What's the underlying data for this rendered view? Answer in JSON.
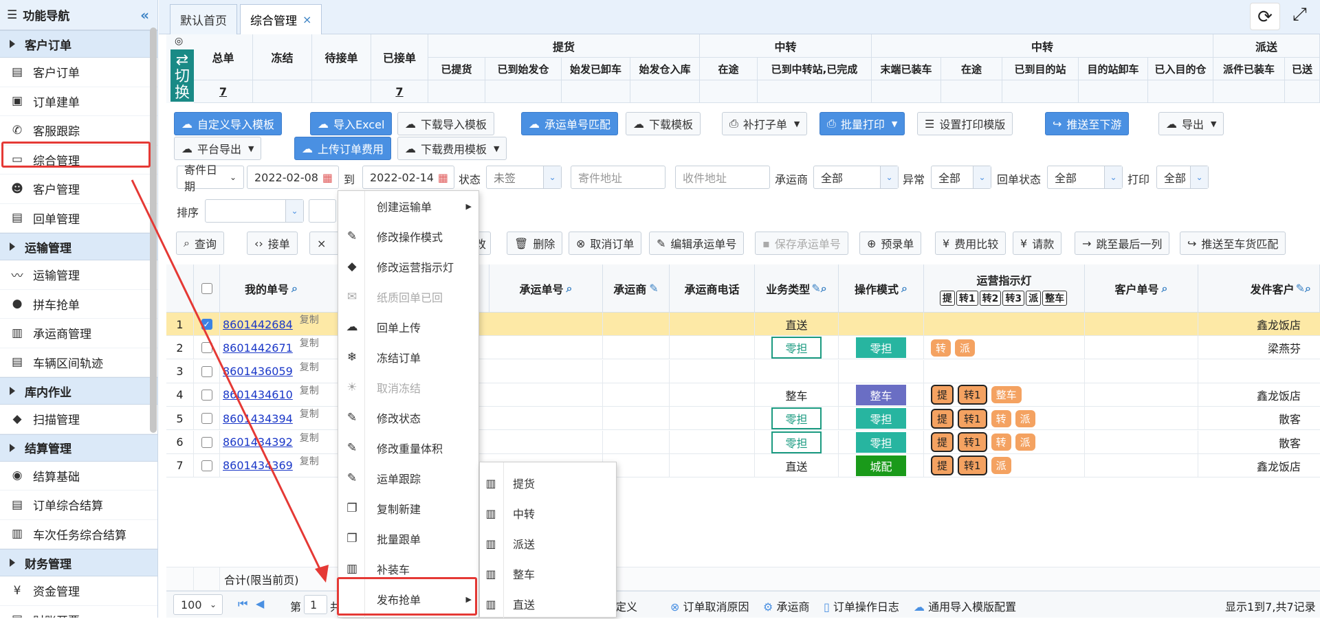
{
  "sidebar": {
    "title": "功能导航",
    "groups": [
      {
        "label": "客户订单",
        "items": [
          "客户订单",
          "订单建单",
          "客服跟踪",
          "综合管理",
          "客户管理",
          "回单管理"
        ]
      },
      {
        "label": "运输管理",
        "items": [
          "运输管理",
          "拼车抢单",
          "承运商管理",
          "车辆区间轨迹"
        ]
      },
      {
        "label": "库内作业",
        "items": [
          "扫描管理"
        ]
      },
      {
        "label": "结算管理",
        "items": [
          "结算基础",
          "订单综合结算",
          "车次任务综合结算"
        ]
      },
      {
        "label": "财务管理",
        "items": [
          "资金管理",
          "财账开票"
        ]
      }
    ]
  },
  "tabs": {
    "home": "默认首页",
    "active": "综合管理",
    "close": "×"
  },
  "stats": {
    "switch": "⇄切换",
    "cols": [
      "总单",
      "冻结",
      "待接单",
      "已接单"
    ],
    "groups": [
      "提货",
      "中转",
      "中转",
      "派送"
    ],
    "sub": [
      "已提货",
      "已到始发仓",
      "始发已卸车",
      "始发仓入库",
      "在途",
      "已到中转站,已完成",
      "末端已装车",
      "在途",
      "已到目的站",
      "目的站卸车",
      "已入目的仓",
      "派件已装车",
      "已送"
    ],
    "total": "7",
    "accepted": "7"
  },
  "toolbar": {
    "custom_import": "自定义导入模板",
    "import_excel": "导入Excel",
    "download_import": "下载导入模板",
    "carrier_match": "承运单号匹配",
    "download_tpl": "下载模板",
    "reprint": "补打子单",
    "batch_print": "批量打印",
    "print_tpl": "设置打印模版",
    "push_downstream": "推送至下游",
    "export": "导出",
    "platform_export": "平台导出",
    "upload_fee": "上传订单费用",
    "download_fee": "下载费用模板"
  },
  "filters": {
    "date_type": "寄件日期",
    "date_from": "2022-02-08",
    "to": "到",
    "date_to": "2022-02-14",
    "status_label": "状态",
    "status": "未签",
    "sender_ph": "寄件地址",
    "receiver_ph": "收件地址",
    "carrier_label": "承运商",
    "carrier": "全部",
    "abnormal_label": "异常",
    "abnormal": "全部",
    "receipt_label": "回单状态",
    "receipt": "全部",
    "print_label": "打印",
    "print": "全部",
    "sort_label": "排序"
  },
  "actions": {
    "query": "查询",
    "accept": "接单",
    "modify_tail": "改",
    "delete": "删除",
    "cancel": "取消订单",
    "edit_carrier_no": "编辑承运单号",
    "save_carrier_no": "保存承运单号",
    "prebook": "预录单",
    "fee_compare": "费用比较",
    "request": "请款",
    "jump_last": "跳至最后一列",
    "push_match": "推送至车货匹配"
  },
  "table": {
    "headers": {
      "my_no": "我的单号",
      "carrier_no": "承运单号",
      "carrier": "承运商",
      "carrier_phone": "承运商电话",
      "biz_type": "业务类型",
      "op_mode": "操作模式",
      "lamp": "运营指示灯",
      "cust_no": "客户单号",
      "sender": "发件客户"
    },
    "lamp_keys": [
      "提",
      "转1",
      "转2",
      "转3",
      "派",
      "整车"
    ],
    "copy": "复制",
    "rows": [
      {
        "idx": "1",
        "no": "8601442684",
        "biz": "直送",
        "op": "",
        "lamps": [],
        "sender": "鑫龙饭店",
        "checked": true
      },
      {
        "idx": "2",
        "no": "8601442671",
        "biz": "零担",
        "op": "零担",
        "lamps": [
          "转",
          "派"
        ],
        "sender": "梁燕芬",
        "checked": false
      },
      {
        "idx": "3",
        "no": "8601436059",
        "biz": "",
        "op": "",
        "lamps": [],
        "sender": "",
        "checked": false
      },
      {
        "idx": "4",
        "no": "8601434610",
        "biz": "整车",
        "op": "整车",
        "lamps": [
          "提",
          "转1",
          "整车"
        ],
        "sender": "鑫龙饭店",
        "checked": false
      },
      {
        "idx": "5",
        "no": "8601434394",
        "biz": "零担",
        "op": "零担",
        "lamps": [
          "提",
          "转1",
          "转",
          "派"
        ],
        "sender": "散客",
        "checked": false
      },
      {
        "idx": "6",
        "no": "8601434392",
        "biz": "零担",
        "op": "零担",
        "lamps": [
          "提",
          "转1",
          "转",
          "派"
        ],
        "sender": "散客",
        "checked": false
      },
      {
        "idx": "7",
        "no": "8601434369",
        "biz": "直送",
        "op": "城配",
        "lamps": [
          "提",
          "转1",
          "派"
        ],
        "sender": "鑫龙饭店",
        "checked": false
      }
    ],
    "sum_label": "合计(限当前页)"
  },
  "context_menu": [
    "创建运输单",
    "修改操作模式",
    "修改运营指示灯",
    "纸质回单已回",
    "回单上传",
    "冻结订单",
    "取消冻结",
    "修改状态",
    "修改重量体积",
    "运单跟踪",
    "复制新建",
    "批量跟单",
    "补装车",
    "发布抢单"
  ],
  "submenu": [
    "提货",
    "中转",
    "派送",
    "整车",
    "直送"
  ],
  "footer": {
    "page_size": "100",
    "page_prefix": "第",
    "page": "1",
    "page_suffix": "共",
    "field_def": "字段定义",
    "cancel_reason": "订单取消原因",
    "carrier": "承运商",
    "op_log": "订单操作日志",
    "import_cfg": "通用导入模版配置",
    "summary": "显示1到7,共7记录"
  }
}
